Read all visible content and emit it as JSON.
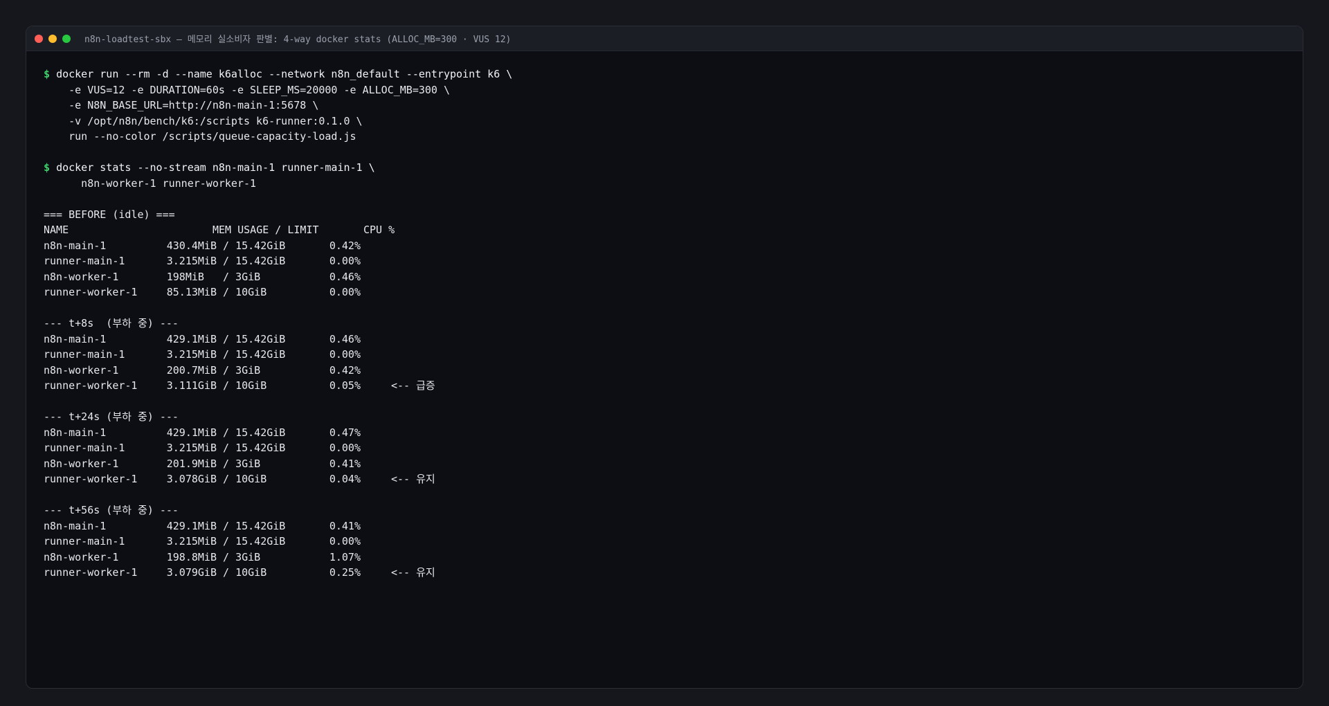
{
  "window": {
    "title": "n8n-loadtest-sbx — 메모리 실소비자 판별: 4-way docker stats (ALLOC_MB=300 · VUS 12)"
  },
  "prompt_symbol": "$",
  "command1": {
    "line1": "docker run --rm -d --name k6alloc --network n8n_default --entrypoint k6 \\",
    "line2": "    -e VUS=12 -e DURATION=60s -e SLEEP_MS=20000 -e ALLOC_MB=300 \\",
    "line3": "    -e N8N_BASE_URL=http://n8n-main-1:5678 \\",
    "line4": "    -v /opt/n8n/bench/k6:/scripts k6-runner:0.1.0 \\",
    "line5": "    run --no-color /scripts/queue-capacity-load.js"
  },
  "command2": {
    "line1": "docker stats --no-stream n8n-main-1 runner-main-1 \\",
    "line2": "      n8n-worker-1 runner-worker-1"
  },
  "header": {
    "name": "NAME",
    "mem": "MEM USAGE / LIMIT",
    "cpu": "CPU %"
  },
  "sections": [
    {
      "title": "=== BEFORE (idle) ===",
      "rows": [
        {
          "name": "n8n-main-1",
          "used": "430.4MiB",
          "limit": "15.42GiB",
          "cpu": "0.42%",
          "note": ""
        },
        {
          "name": "runner-main-1",
          "used": "3.215MiB",
          "limit": "15.42GiB",
          "cpu": "0.00%",
          "note": ""
        },
        {
          "name": "n8n-worker-1",
          "used": "198MiB  ",
          "limit": "3GiB",
          "cpu": "0.46%",
          "note": ""
        },
        {
          "name": "runner-worker-1",
          "used": "85.13MiB",
          "limit": "10GiB",
          "cpu": "0.00%",
          "note": ""
        }
      ]
    },
    {
      "title": "--- t+8s  (부하 중) ---",
      "rows": [
        {
          "name": "n8n-main-1",
          "used": "429.1MiB",
          "limit": "15.42GiB",
          "cpu": "0.46%",
          "note": ""
        },
        {
          "name": "runner-main-1",
          "used": "3.215MiB",
          "limit": "15.42GiB",
          "cpu": "0.00%",
          "note": ""
        },
        {
          "name": "n8n-worker-1",
          "used": "200.7MiB",
          "limit": "3GiB",
          "cpu": "0.42%",
          "note": ""
        },
        {
          "name": "runner-worker-1",
          "used": "3.111GiB",
          "limit": "10GiB",
          "cpu": "0.05%",
          "note": "<-- 급증"
        }
      ]
    },
    {
      "title": "--- t+24s (부하 중) ---",
      "rows": [
        {
          "name": "n8n-main-1",
          "used": "429.1MiB",
          "limit": "15.42GiB",
          "cpu": "0.47%",
          "note": ""
        },
        {
          "name": "runner-main-1",
          "used": "3.215MiB",
          "limit": "15.42GiB",
          "cpu": "0.00%",
          "note": ""
        },
        {
          "name": "n8n-worker-1",
          "used": "201.9MiB",
          "limit": "3GiB",
          "cpu": "0.41%",
          "note": ""
        },
        {
          "name": "runner-worker-1",
          "used": "3.078GiB",
          "limit": "10GiB",
          "cpu": "0.04%",
          "note": "<-- 유지"
        }
      ]
    },
    {
      "title": "--- t+56s (부하 중) ---",
      "rows": [
        {
          "name": "n8n-main-1",
          "used": "429.1MiB",
          "limit": "15.42GiB",
          "cpu": "0.41%",
          "note": ""
        },
        {
          "name": "runner-main-1",
          "used": "3.215MiB",
          "limit": "15.42GiB",
          "cpu": "0.00%",
          "note": ""
        },
        {
          "name": "n8n-worker-1",
          "used": "198.8MiB",
          "limit": "3GiB",
          "cpu": "1.07%",
          "note": ""
        },
        {
          "name": "runner-worker-1",
          "used": "3.079GiB",
          "limit": "10GiB",
          "cpu": "0.25%",
          "note": "<-- 유지"
        }
      ]
    }
  ]
}
